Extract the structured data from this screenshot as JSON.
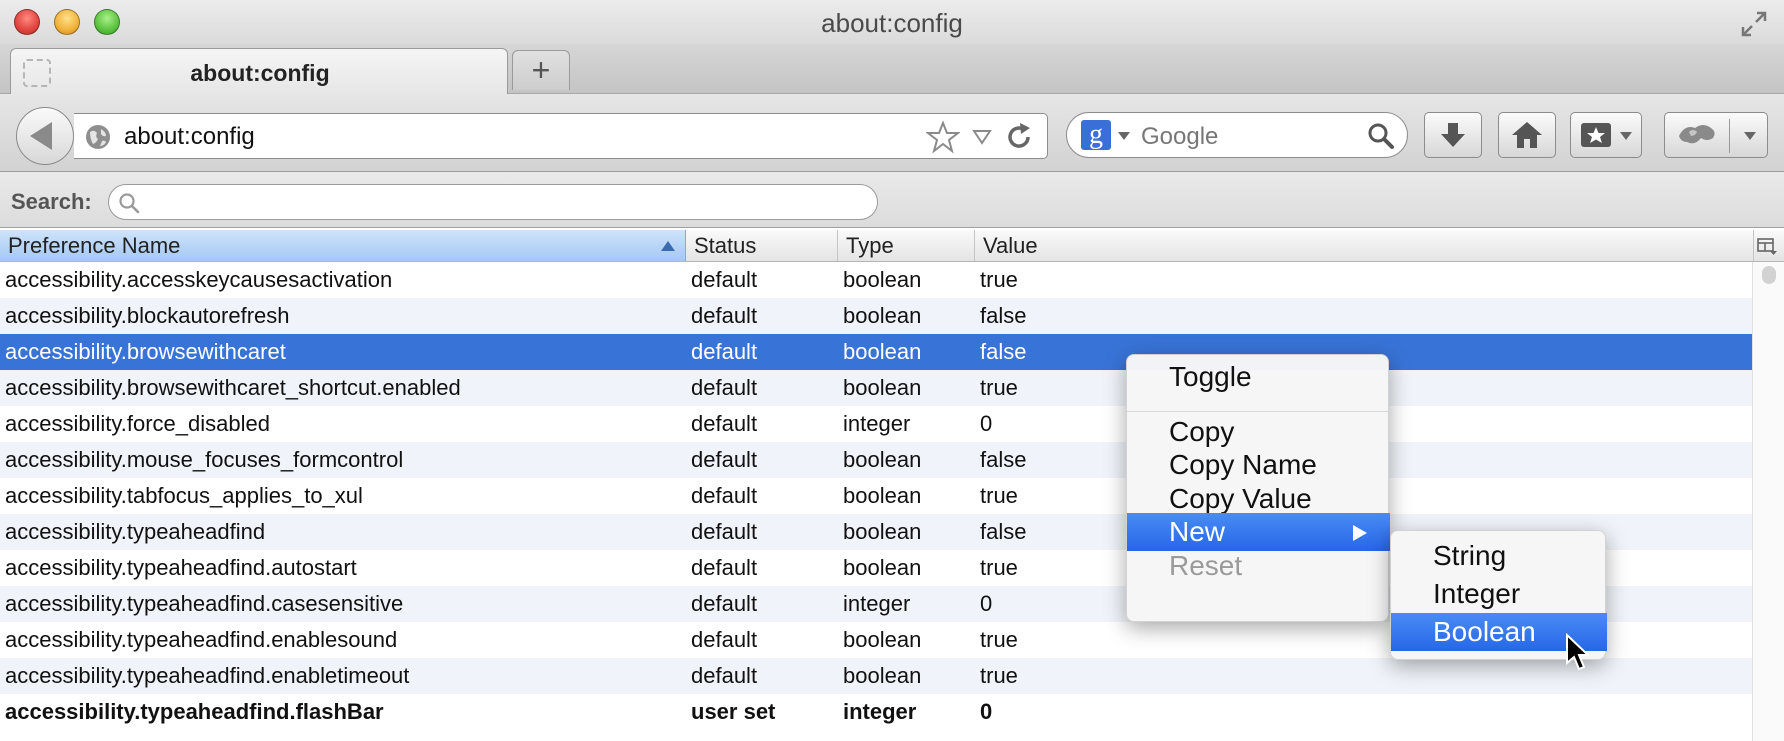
{
  "window": {
    "title": "about:config"
  },
  "tabs": [
    {
      "label": "about:config"
    }
  ],
  "navbar": {
    "url": "about:config",
    "search_placeholder": "Google",
    "search_engine_glyph": "g"
  },
  "filter": {
    "label": "Search:",
    "value": ""
  },
  "columns": {
    "name": "Preference Name",
    "status": "Status",
    "type": "Type",
    "value": "Value"
  },
  "rows": [
    {
      "name": "accessibility.accesskeycausesactivation",
      "status": "default",
      "type": "boolean",
      "value": "true"
    },
    {
      "name": "accessibility.blockautorefresh",
      "status": "default",
      "type": "boolean",
      "value": "false"
    },
    {
      "name": "accessibility.browsewithcaret",
      "status": "default",
      "type": "boolean",
      "value": "false"
    },
    {
      "name": "accessibility.browsewithcaret_shortcut.enabled",
      "status": "default",
      "type": "boolean",
      "value": "true"
    },
    {
      "name": "accessibility.force_disabled",
      "status": "default",
      "type": "integer",
      "value": "0"
    },
    {
      "name": "accessibility.mouse_focuses_formcontrol",
      "status": "default",
      "type": "boolean",
      "value": "false"
    },
    {
      "name": "accessibility.tabfocus_applies_to_xul",
      "status": "default",
      "type": "boolean",
      "value": "true"
    },
    {
      "name": "accessibility.typeaheadfind",
      "status": "default",
      "type": "boolean",
      "value": "false"
    },
    {
      "name": "accessibility.typeaheadfind.autostart",
      "status": "default",
      "type": "boolean",
      "value": "true"
    },
    {
      "name": "accessibility.typeaheadfind.casesensitive",
      "status": "default",
      "type": "integer",
      "value": "0"
    },
    {
      "name": "accessibility.typeaheadfind.enablesound",
      "status": "default",
      "type": "boolean",
      "value": "true"
    },
    {
      "name": "accessibility.typeaheadfind.enabletimeout",
      "status": "default",
      "type": "boolean",
      "value": "true"
    },
    {
      "name": "accessibility.typeaheadfind.flashBar",
      "status": "user set",
      "type": "integer",
      "value": "0"
    }
  ],
  "context_menu": {
    "toggle": "Toggle",
    "copy": "Copy",
    "copy_name": "Copy Name",
    "copy_value": "Copy Value",
    "new": "New",
    "reset": "Reset"
  },
  "submenu": {
    "string": "String",
    "integer": "Integer",
    "boolean": "Boolean"
  },
  "colors": {
    "selection": "#3874d7",
    "menu_highlight": "#2f72ee"
  }
}
